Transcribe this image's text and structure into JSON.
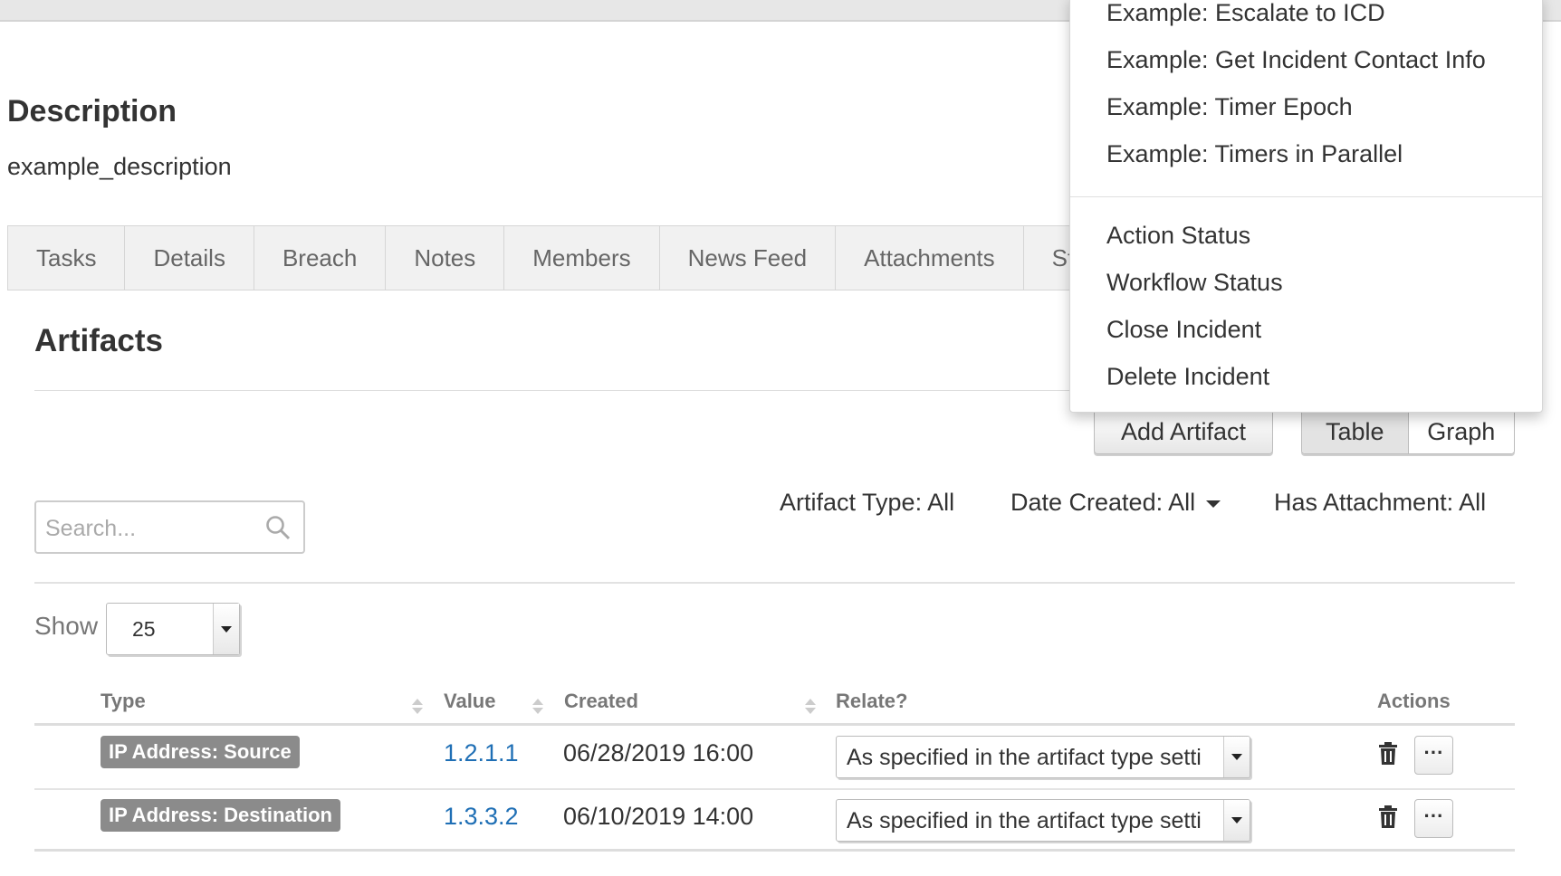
{
  "description": {
    "heading": "Description",
    "text": "example_description"
  },
  "tabs": [
    "Tasks",
    "Details",
    "Breach",
    "Notes",
    "Members",
    "News Feed",
    "Attachments",
    "Stats"
  ],
  "artifacts": {
    "heading": "Artifacts",
    "add_button": "Add Artifact",
    "view_toggle": {
      "table": "Table",
      "graph": "Graph",
      "selected": "Table"
    },
    "search_placeholder": "Search...",
    "filters": {
      "artifact_type": "Artifact Type: All",
      "date_created": "Date Created: All",
      "has_attachment": "Has Attachment: All"
    },
    "show_label": "Show",
    "page_size": "25",
    "columns": {
      "type": "Type",
      "value": "Value",
      "created": "Created",
      "relate": "Relate?",
      "actions": "Actions"
    },
    "rows": [
      {
        "type": "IP Address: Source",
        "value": "1.2.1.1",
        "created": "06/28/2019 16:00",
        "relate": "As specified in the artifact type setti",
        "more": "···"
      },
      {
        "type": "IP Address: Destination",
        "value": "1.3.3.2",
        "created": "06/10/2019 14:00",
        "relate": "As specified in the artifact type setti",
        "more": "···"
      }
    ]
  },
  "actions_menu": {
    "examples": [
      "Example: Escalate to ICD",
      "Example: Get Incident Contact Info",
      "Example: Timer Epoch",
      "Example: Timers in Parallel"
    ],
    "system": [
      "Action Status",
      "Workflow Status",
      "Close Incident",
      "Delete Incident"
    ]
  },
  "colors": {
    "link": "#1f6fb5",
    "badge": "#8b8b8b",
    "tabs_bg": "#f1f1f1"
  },
  "icons": [
    "search-icon",
    "chevron-down-icon",
    "sort-icon",
    "trash-icon",
    "more-icon"
  ]
}
